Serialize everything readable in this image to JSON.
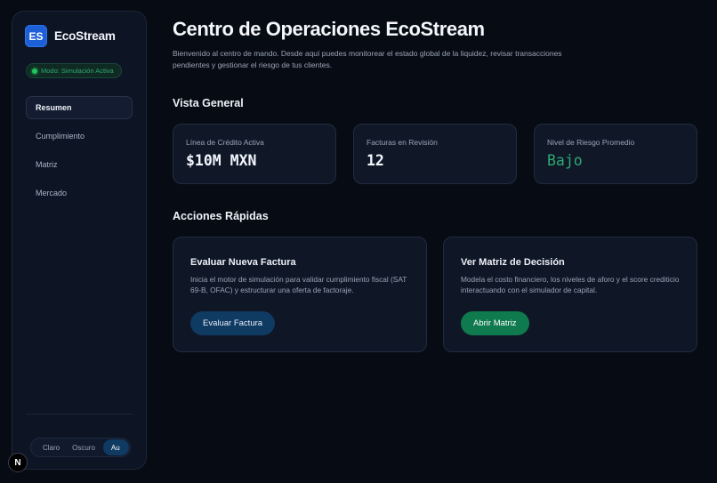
{
  "sidebar": {
    "brand_initials": "ES",
    "brand_name": "EcoStream",
    "mode_badge": "Modo: Simulación Activa",
    "nav": [
      {
        "label": "Resumen",
        "active": true
      },
      {
        "label": "Cumplimiento",
        "active": false
      },
      {
        "label": "Matriz",
        "active": false
      },
      {
        "label": "Mercado",
        "active": false
      }
    ],
    "theme": {
      "options": [
        "Claro",
        "Oscuro",
        "Au"
      ],
      "selected": "Au"
    },
    "n_badge": "N"
  },
  "main": {
    "title": "Centro de Operaciones EcoStream",
    "description": "Bienvenido al centro de mando. Desde aquí puedes monitorear el estado global de la liquidez, revisar transacciones pendientes y gestionar el riesgo de tus clientes.",
    "overview": {
      "title": "Vista General",
      "stats": [
        {
          "label": "Línea de Crédito Activa",
          "value": "$10M MXN"
        },
        {
          "label": "Facturas en Revisión",
          "value": "12"
        },
        {
          "label": "Nivel de Riesgo Promedio",
          "value": "Bajo"
        }
      ]
    },
    "quick_actions": {
      "title": "Acciones Rápidas",
      "cards": [
        {
          "title": "Evaluar Nueva Factura",
          "description": "Inicia el motor de simulación para validar cumplimiento fiscal (SAT 69-B, OFAC) y estructurar una oferta de factoraje.",
          "button": "Evaluar Factura"
        },
        {
          "title": "Ver Matriz de Decisión",
          "description": "Modela el costo financiero, los niveles de aforo y el score crediticio interactuando con el simulador de capital.",
          "button": "Abrir Matriz"
        }
      ]
    }
  },
  "colors": {
    "background": "#070b14",
    "accent_blue": "#1d5fd6",
    "accent_green": "#2fa873",
    "button_blue": "#0f3a62",
    "button_green": "#0f7a4e"
  }
}
